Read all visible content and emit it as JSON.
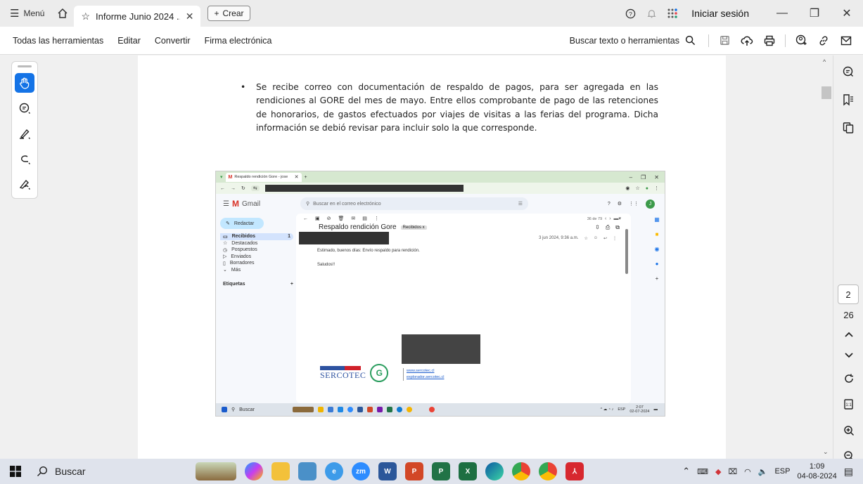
{
  "titlebar": {
    "menu_label": "Menú",
    "tab_label": "Informe Junio 2024 ...",
    "create_label": "Crear",
    "login_label": "Iniciar sesión"
  },
  "toolbar": {
    "items": [
      "Todas las herramientas",
      "Editar",
      "Convertir",
      "Firma electrónica"
    ],
    "search_label": "Buscar texto o herramientas"
  },
  "document": {
    "bullet": "•",
    "paragraph": "Se recibe correo con documentación de respaldo de pagos, para ser agregada en las rendiciones al GORE del mes de mayo.  Entre ellos comprobante de pago de las retenciones de honorarios, de gastos efectuados por viajes de visitas a las ferias del programa. Dicha información se debió revisar para incluir solo la que corresponde."
  },
  "screenshot": {
    "tab_title": "Respaldo rendición Gore - jose",
    "gmail_label": "Gmail",
    "search_placeholder": "Buscar en el correo electrónico",
    "avatar": "J",
    "compose": "Redactar",
    "nav": [
      {
        "label": "Recibidos",
        "count": "1"
      },
      {
        "label": "Destacados",
        "count": ""
      },
      {
        "label": "Pospuestos",
        "count": ""
      },
      {
        "label": "Enviados",
        "count": ""
      },
      {
        "label": "Borradores",
        "count": ""
      },
      {
        "label": "Más",
        "count": ""
      }
    ],
    "labels_heading": "Etiquetas",
    "pagination": "36 de 79",
    "subject": "Respaldo rendición Gore",
    "chip": "Recibidos x",
    "date": "3 jun 2024, 9:36 a.m.",
    "body_line1": "Estimado, buenos días: Envío respaldo para rendición.",
    "body_line2": "Saludos!!",
    "signature_brand": "SERCOTEC",
    "link1": "www.sercotec.cl",
    "link2": "explorador.sercotec.cl",
    "taskbar_search": "Buscar",
    "taskbar_lang": "ESP",
    "taskbar_time": "2:07",
    "taskbar_date": "02-07-2024"
  },
  "pager": {
    "current": "2",
    "total": "26"
  },
  "taskbar": {
    "search_label": "Buscar",
    "lang": "ESP",
    "time": "1:09",
    "date": "04-08-2024"
  },
  "colors": {
    "accent": "#1473e6",
    "gmail_red": "#d93025",
    "sercotec_blue": "#2d52a0"
  }
}
